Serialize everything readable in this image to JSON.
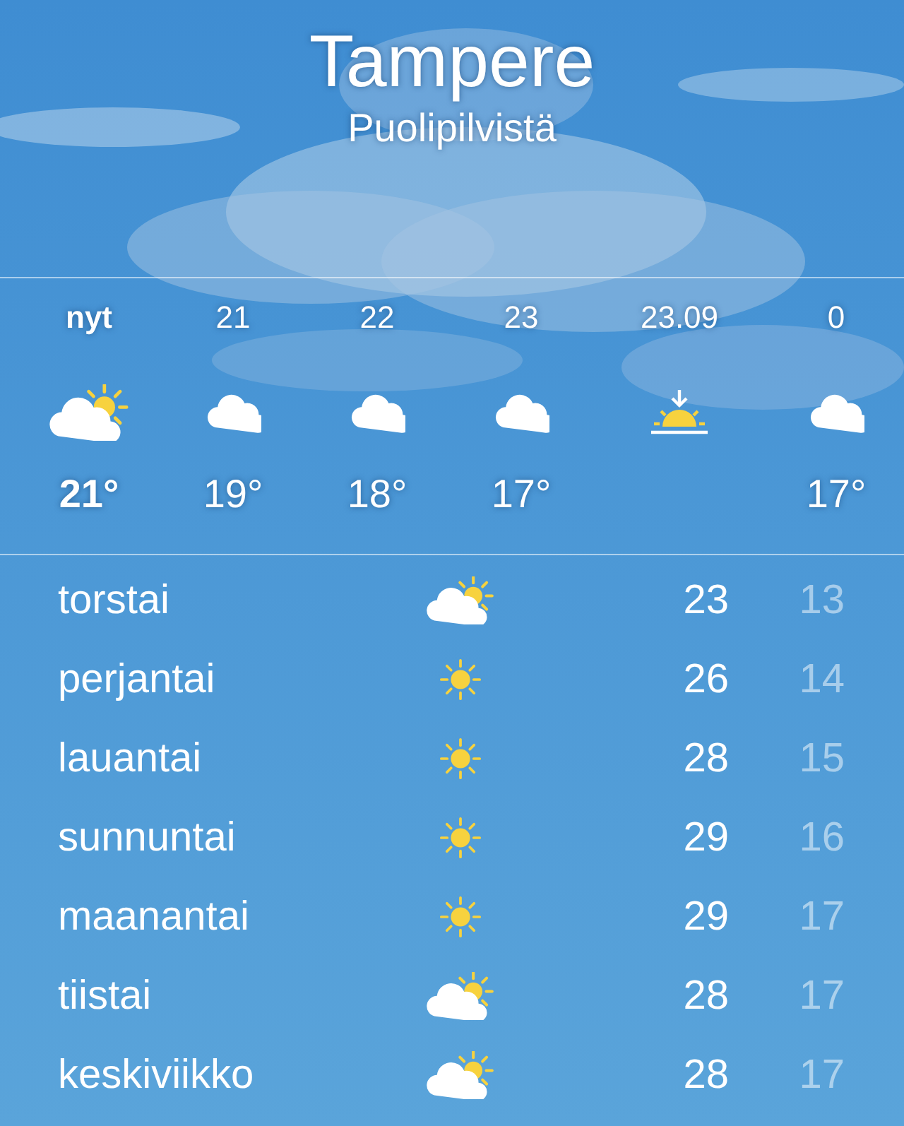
{
  "location": {
    "city": "Tampere",
    "condition": "Puolipilvistä"
  },
  "hourly": [
    {
      "time": "nyt",
      "kind": "partly_sunny",
      "temp": "21°",
      "current": true
    },
    {
      "time": "21",
      "kind": "cloudy",
      "temp": "19°",
      "current": false
    },
    {
      "time": "22",
      "kind": "cloudy",
      "temp": "18°",
      "current": false
    },
    {
      "time": "23",
      "kind": "cloudy",
      "temp": "17°",
      "current": false
    },
    {
      "time": "23.09",
      "kind": "sunset",
      "current": false
    },
    {
      "time": "0",
      "kind": "cloudy",
      "temp": "17°",
      "current": false
    }
  ],
  "daily": [
    {
      "day": "torstai",
      "kind": "partly_sunny",
      "high": "23",
      "low": "13"
    },
    {
      "day": "perjantai",
      "kind": "sunny",
      "high": "26",
      "low": "14"
    },
    {
      "day": "lauantai",
      "kind": "sunny",
      "high": "28",
      "low": "15"
    },
    {
      "day": "sunnuntai",
      "kind": "sunny",
      "high": "29",
      "low": "16"
    },
    {
      "day": "maanantai",
      "kind": "sunny",
      "high": "29",
      "low": "17"
    },
    {
      "day": "tiistai",
      "kind": "partly_sunny",
      "high": "28",
      "low": "17"
    },
    {
      "day": "keskiviikko",
      "kind": "partly_sunny",
      "high": "28",
      "low": "17"
    }
  ]
}
